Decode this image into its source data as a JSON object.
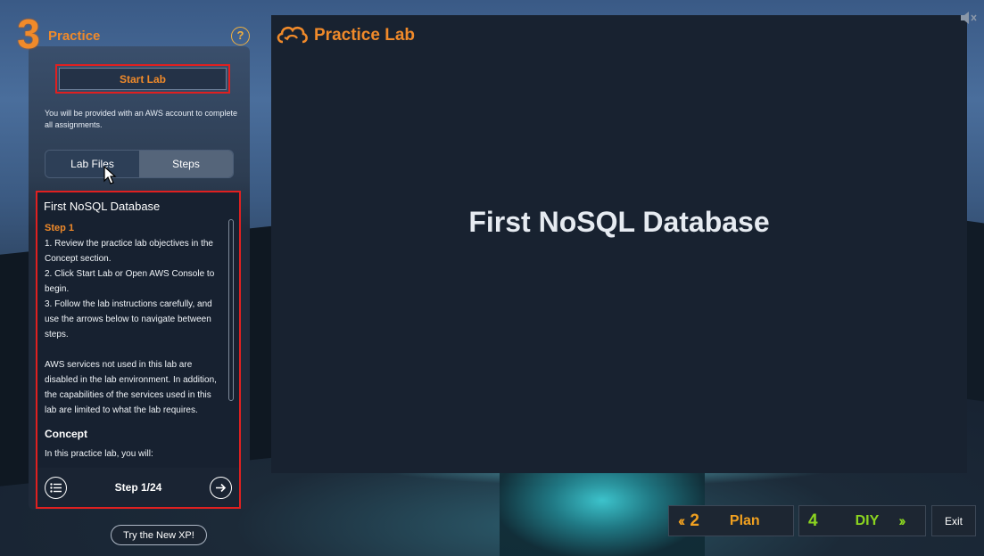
{
  "step": {
    "number": "3",
    "title": "Practice",
    "help": "?"
  },
  "panel": {
    "start_lab_label": "Start Lab",
    "intro_text": "You will be provided with an AWS account to complete all assignments.",
    "tabs": [
      "Lab Files",
      "Steps"
    ],
    "lab_title": "First NoSQL Database",
    "step_label": "Step 1",
    "instructions": [
      "1. Review the practice lab objectives in the Concept section.",
      "2. Click Start Lab or Open AWS Console to begin.",
      "3. Follow the lab instructions carefully, and use the arrows below to navigate between steps."
    ],
    "note": "AWS services not used in this lab are disabled in the lab environment. In addition, the capabilities of the services used in this lab are limited to what the lab requires.",
    "concept_heading": "Concept",
    "concept_text": "In this practice lab, you will:",
    "step_counter": "Step 1/24"
  },
  "try_new_label": "Try the New XP!",
  "stage": {
    "logo_text": "Practice Lab",
    "title": "First NoSQL Database"
  },
  "bottom_nav": {
    "prev": {
      "number": "2",
      "label": "Plan"
    },
    "next": {
      "number": "4",
      "label": "DIY"
    },
    "exit_label": "Exit"
  },
  "colors": {
    "accent_orange": "#f08a2a",
    "accent_green": "#8bd420",
    "highlight_red": "#e02020"
  }
}
